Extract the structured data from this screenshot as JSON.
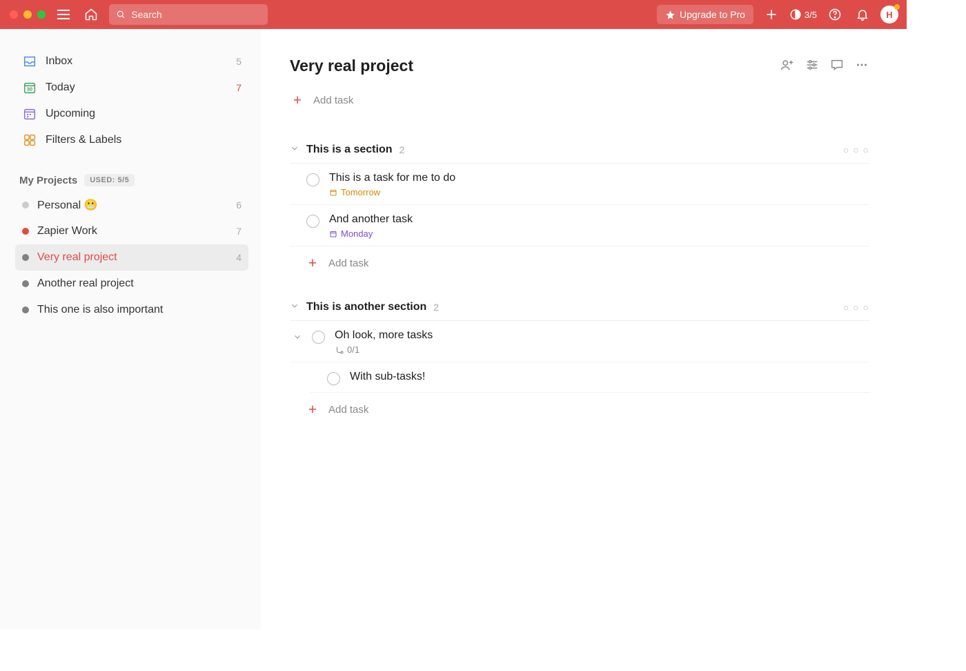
{
  "topbar": {
    "search_placeholder": "Search",
    "upgrade_label": "Upgrade to Pro",
    "productivity_counter": "3/5",
    "avatar_initial": "H"
  },
  "sidebar": {
    "nav": {
      "inbox": {
        "label": "Inbox",
        "count": "5"
      },
      "today": {
        "label": "Today",
        "count": "7"
      },
      "upcoming": {
        "label": "Upcoming"
      },
      "filters": {
        "label": "Filters & Labels"
      }
    },
    "projects_header": "My Projects",
    "used_badge": "USED: 5/5",
    "projects": [
      {
        "name": "Personal 😬",
        "count": "6",
        "color": "#CCCCCC"
      },
      {
        "name": "Zapier Work",
        "count": "7",
        "color": "#E24A3F"
      },
      {
        "name": "Very real project",
        "count": "4",
        "color": "#808080",
        "active": true
      },
      {
        "name": "Another real project",
        "count": "",
        "color": "#808080"
      },
      {
        "name": "This one is also important",
        "count": "",
        "color": "#808080"
      }
    ]
  },
  "main": {
    "title": "Very real project",
    "add_task_label": "Add task",
    "sections": [
      {
        "name": "This is a section",
        "count": "2",
        "tasks": [
          {
            "title": "This is a task for me to do",
            "due": "Tomorrow",
            "due_class": "tomorrow"
          },
          {
            "title": "And another task",
            "due": "Monday",
            "due_class": "monday"
          }
        ]
      },
      {
        "name": "This is another section",
        "count": "2",
        "tasks": [
          {
            "title": "Oh look, more tasks",
            "subprogress": "0/1",
            "has_chevron": true,
            "subtasks": [
              {
                "title": "With sub-tasks!"
              }
            ]
          }
        ]
      }
    ]
  }
}
